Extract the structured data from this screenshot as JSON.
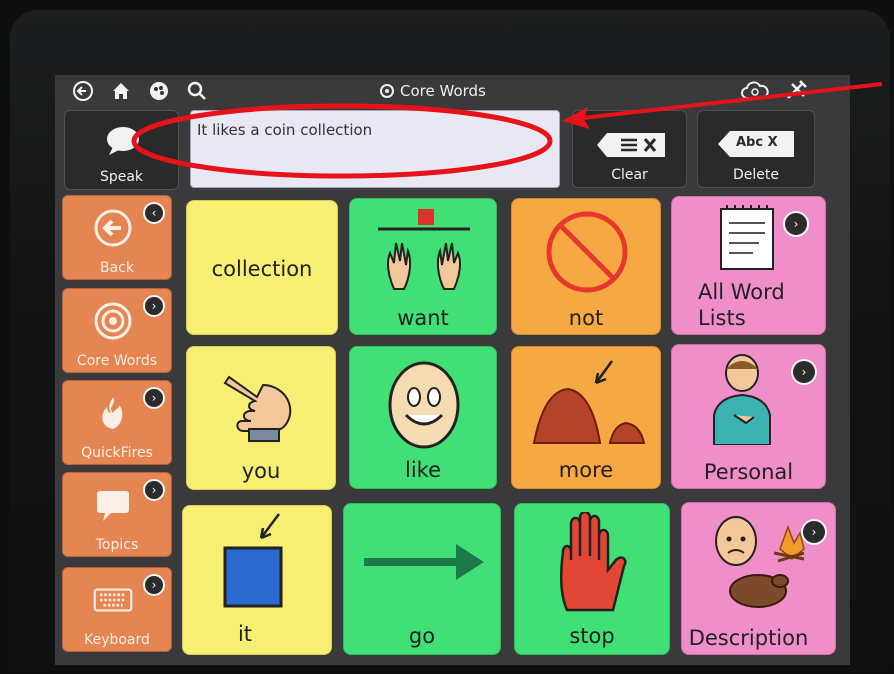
{
  "topbar": {
    "title": "Core Words",
    "icons": [
      "back-arrow-icon",
      "home-icon",
      "palette-icon",
      "search-icon",
      "cloud-sync-icon",
      "tools-icon"
    ]
  },
  "speak_bar": {
    "speak_label": "Speak",
    "message_text": "It likes a coin collection",
    "clear_label": "Clear",
    "delete_label": "Delete",
    "delete_icon_text": "Abc X"
  },
  "nav": {
    "items": [
      {
        "label": "Back",
        "icon": "back-arrow-icon"
      },
      {
        "label": "Core Words",
        "icon": "target-icon"
      },
      {
        "label": "QuickFires",
        "icon": "fire-icon"
      },
      {
        "label": "Topics",
        "icon": "speech-bubble-icon"
      },
      {
        "label": "Keyboard",
        "icon": "keyboard-icon"
      }
    ]
  },
  "grid": {
    "rows": [
      [
        {
          "word": "collection",
          "color": "yellow",
          "icon": "none"
        },
        {
          "word": "want",
          "color": "green",
          "icon": "want-hands-icon"
        },
        {
          "word": "not",
          "color": "orange",
          "icon": "prohibited-icon"
        },
        {
          "word": "All Word Lists",
          "color": "pink",
          "icon": "notepad-icon"
        }
      ],
      [
        {
          "word": "you",
          "color": "yellow",
          "icon": "pointing-hand-icon"
        },
        {
          "word": "like",
          "color": "green",
          "icon": "smiling-egg-icon"
        },
        {
          "word": "more",
          "color": "orange",
          "icon": "pile-icon"
        },
        {
          "word": "Personal",
          "color": "pink",
          "icon": "person-icon"
        }
      ],
      [
        {
          "word": "it",
          "color": "yellow",
          "icon": "blue-square-arrow-icon"
        },
        {
          "word": "go",
          "color": "green",
          "icon": "right-arrow-icon"
        },
        {
          "word": "stop",
          "color": "green",
          "icon": "stop-hand-icon"
        },
        {
          "word": "Description",
          "color": "pink",
          "icon": "description-collage-icon"
        }
      ]
    ]
  },
  "colors": {
    "yellow": "#f6ef73",
    "green": "#40e076",
    "orange": "#f6a843",
    "pink": "#ef8ec8",
    "nav_orange": "#e58551",
    "annotation_red": "#e8121a"
  }
}
